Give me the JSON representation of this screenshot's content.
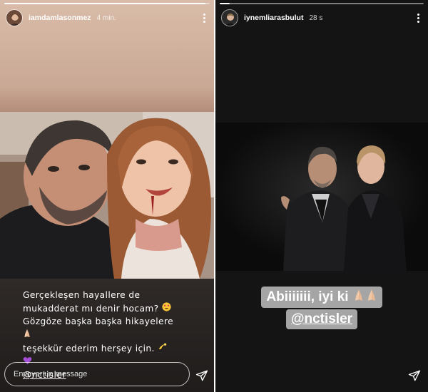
{
  "left_story": {
    "progress": 0.98,
    "username": "iamdamlasonmez",
    "time": "4 min.",
    "caption": {
      "line1": "Gerçekleşen hayallere de",
      "line2": "mukadderat mı denir hocam?",
      "line3": "Gözgöze başka başka hikayelere",
      "line5": "teşekkür ederim herşey için.",
      "mention": "@nctisler"
    },
    "message_placeholder": "Envoyer un message"
  },
  "right_story": {
    "progress": 0.05,
    "username": "iynemliarasbulut",
    "time": "28 s",
    "sticker": {
      "line1": "Abiiiiiii, iyi ki",
      "mention": "@nctisler"
    }
  },
  "icons": {
    "more": "more-vertical-icon",
    "send": "send-icon",
    "prayer": "folded-hands-emoji",
    "heart_eyes": "heart-eyes-emoji",
    "dizzy": "dizzy-emoji",
    "purple_heart": "purple-heart-emoji"
  },
  "colors": {
    "left_top_bg": "#c9a995",
    "right_bg": "#141414",
    "sticker_bg": "#b9b9b9"
  }
}
